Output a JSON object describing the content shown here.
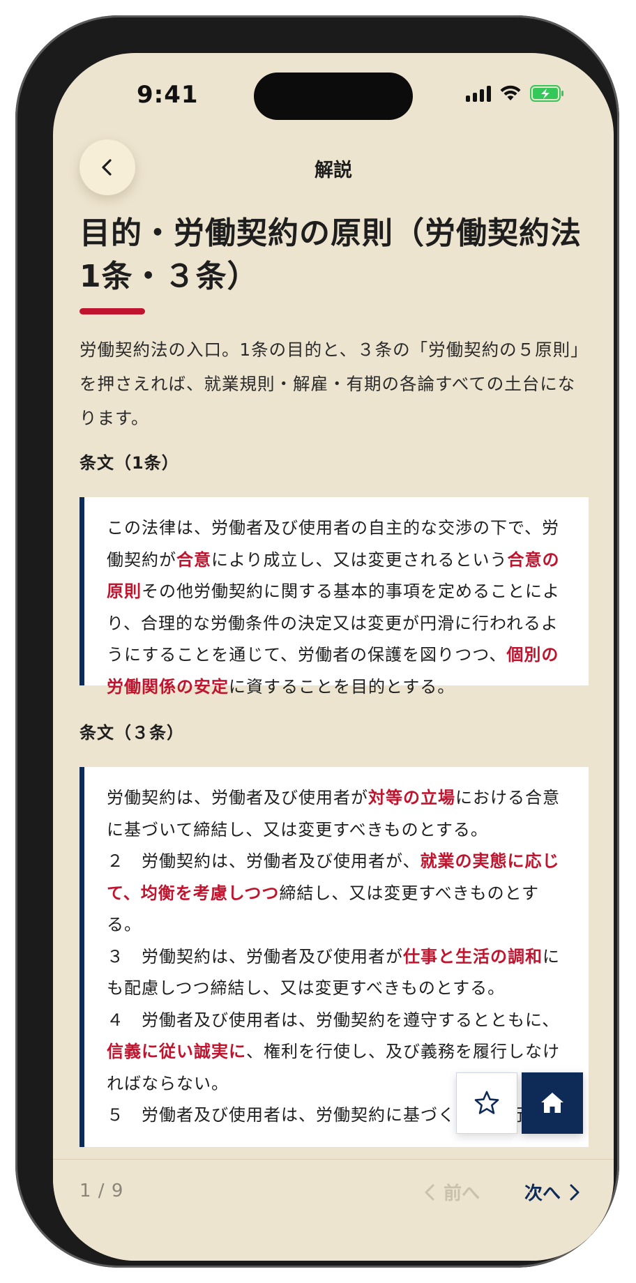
{
  "status_bar": {
    "time": "9:41",
    "icons": [
      "cellular-signal-icon",
      "wifi-icon",
      "battery-charging-icon"
    ],
    "battery_color": "#34c759"
  },
  "nav": {
    "back_icon": "chevron-left-icon",
    "title": "解説"
  },
  "page": {
    "title": "目的・労働契約の原則（労働契約法1条・３条）",
    "accent_color": "#c0142e",
    "intro": "労働契約法の入口。1条の目的と、３条の「労働契約の５原則」を押さえれば、就業規則・解雇・有期の各論すべての土台になります。"
  },
  "article1": {
    "heading": "条文（1条）",
    "segments": [
      {
        "text": "この法律は、労働者及び使用者の自主的な交渉の下で、労働契約が",
        "hl": false
      },
      {
        "text": "合意",
        "hl": true
      },
      {
        "text": "により成立し、又は変更されるという",
        "hl": false
      },
      {
        "text": "合意の原則",
        "hl": true
      },
      {
        "text": "その他労働契約に関する基本的事項を定めることにより、合理的な労働条件の決定又は変更が円滑に行われるようにすることを通じて、労働者の保護を図りつつ、",
        "hl": false
      },
      {
        "text": "個別の労働関係の安定",
        "hl": true
      },
      {
        "text": "に資することを目的とする。",
        "hl": false
      }
    ]
  },
  "article3": {
    "heading": "条文（３条）",
    "paragraphs": [
      [
        {
          "text": "労働契約は、労働者及び使用者が",
          "hl": false
        },
        {
          "text": "対等の立場",
          "hl": true
        },
        {
          "text": "における合意に基づいて締結し、又は変更すべきものとする。",
          "hl": false
        }
      ],
      [
        {
          "text": "２　労働契約は、労働者及び使用者が、",
          "hl": false
        },
        {
          "text": "就業の実態に応じて、均衡を考慮しつつ",
          "hl": true
        },
        {
          "text": "締結し、又は変更すべきものとする。",
          "hl": false
        }
      ],
      [
        {
          "text": "３　労働契約は、労働者及び使用者が",
          "hl": false
        },
        {
          "text": "仕事と生活の調和",
          "hl": true
        },
        {
          "text": "にも配慮しつつ締結し、又は変更すべきものとする。",
          "hl": false
        }
      ],
      [
        {
          "text": "４　労働者及び使用者は、労働契約を遵守するとともに、",
          "hl": false
        },
        {
          "text": "信義に従い誠実に",
          "hl": true
        },
        {
          "text": "、権利を行使し、及び義務を履行しなければならない。",
          "hl": false
        }
      ],
      [
        {
          "text": "５　労働者及び使用者は、労働契約に基づく権利の行使",
          "hl": false
        }
      ]
    ]
  },
  "fab": {
    "bookmark_icon": "star-outline-icon",
    "home_icon": "home-icon",
    "home_bg": "#0e2a56"
  },
  "footer": {
    "page_count": "1 / 9",
    "prev_label": "前へ",
    "next_label": "次へ",
    "prev_enabled": false
  }
}
